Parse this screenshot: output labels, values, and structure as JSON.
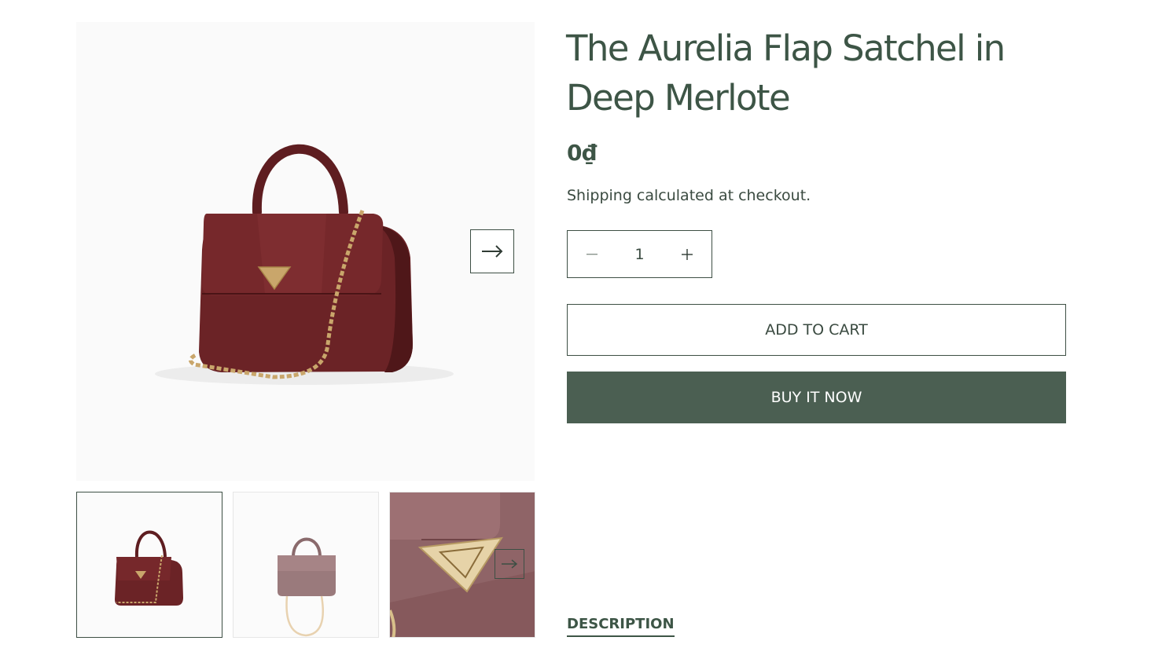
{
  "product": {
    "title": "The Aurelia Flap Satchel in Deep Merlote",
    "price": "0₫",
    "shipping_note": "Shipping calculated at checkout."
  },
  "media": {
    "next_icon": "arrow-right-icon",
    "thumbnails": [
      {
        "name": "front-view",
        "selected": true
      },
      {
        "name": "back-view",
        "selected": false
      },
      {
        "name": "closeup-view",
        "selected": false
      }
    ]
  },
  "quantity": {
    "value": "1",
    "decrease_icon": "minus-icon",
    "increase_icon": "plus-icon"
  },
  "actions": {
    "add_to_cart": "ADD TO CART",
    "buy_now": "BUY IT NOW"
  },
  "tabs": {
    "description": "DESCRIPTION"
  },
  "colors": {
    "brand_green": "#4b5f52",
    "text_green": "#3d5546",
    "bag_burgundy": "#6b2326",
    "hardware_gold": "#c9a66b"
  }
}
